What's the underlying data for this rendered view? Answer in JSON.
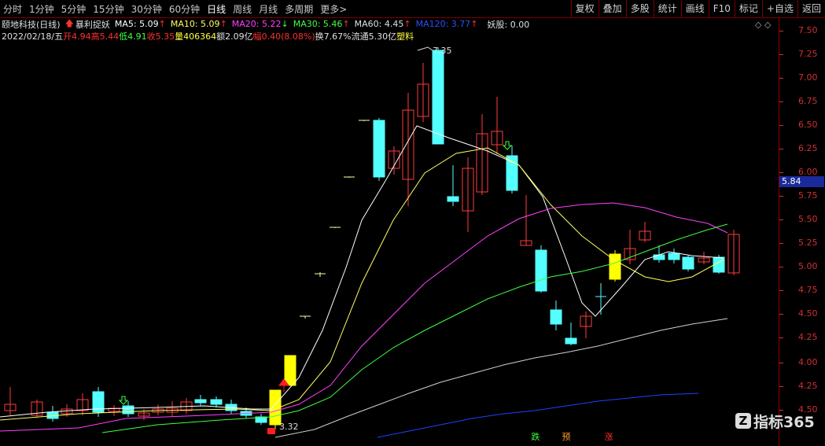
{
  "toolbar": {
    "periods": [
      "分时",
      "1分钟",
      "5分钟",
      "15分钟",
      "30分钟",
      "60分钟",
      "日线",
      "周线",
      "月线",
      "多周期",
      "更多>"
    ],
    "active": "日线",
    "right_buttons": [
      "复权",
      "叠加",
      "多股",
      "统计",
      "画线",
      "F10",
      "标记",
      "+自选",
      "返回"
    ]
  },
  "info_line1": {
    "stock": "颐地科技(日线)",
    "indicator": "暴利捉妖",
    "ma5": "MA5: 5.09",
    "ma10": "MA10: 5.09",
    "ma20": "MA20: 5.22",
    "ma30": "MA30: 5.46",
    "ma60": "MA60: 4.45",
    "ma120": "MA120: 3.77",
    "yao": "妖股: 0.00"
  },
  "info_line2": {
    "date": "2022/02/18/五",
    "open": "开4.94",
    "high": "高5.44",
    "low": "低4.91",
    "close": "收5.35",
    "vol": "量406364",
    "amount": "额2.09亿",
    "change": "幅0.40(8.08%)",
    "turnover": "换7.67%",
    "float": "流通5.30亿",
    "sector": "塑料"
  },
  "axis_ticks": [
    "7.50",
    "7.25",
    "7.00",
    "6.75",
    "6.50",
    "6.25",
    "6.00",
    "5.75",
    "5.50",
    "5.25",
    "5.00",
    "4.75",
    "4.50",
    "4.25",
    "4.00",
    "4.25",
    "4.50"
  ],
  "current_price": "5.84",
  "annotations": {
    "high_label": "7.35",
    "low_label": "3.32"
  },
  "bottom_tags": [
    "跌",
    "预",
    "涨"
  ],
  "logo_text": "指标365",
  "colors": {
    "up": "#ff3c3c",
    "down": "#54ffff",
    "limit": "#ffff00",
    "ma5": "#ffffff",
    "ma10": "#ffff60",
    "ma20": "#ff40ff",
    "ma30": "#40ff40",
    "ma60": "#d0d0d0",
    "ma120": "#2040ff"
  }
}
